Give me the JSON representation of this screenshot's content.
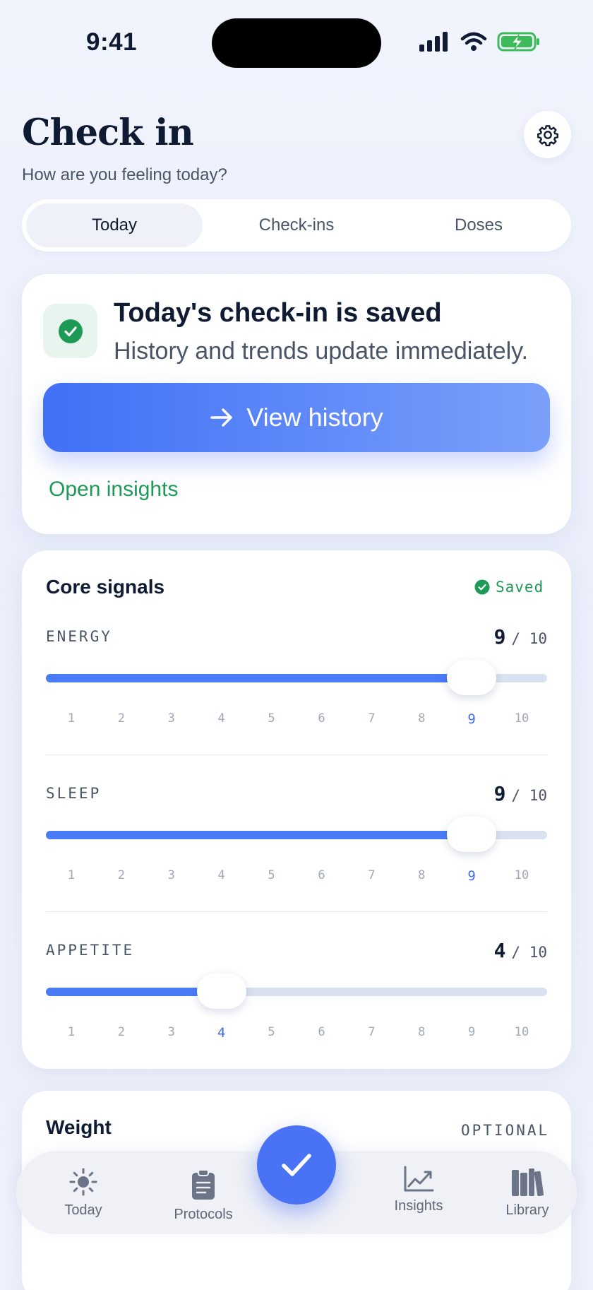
{
  "status_bar": {
    "time": "9:41"
  },
  "header": {
    "title": "Check in",
    "subtitle": "How are you feeling today?"
  },
  "segments": [
    {
      "label": "Today",
      "active": true
    },
    {
      "label": "Check-ins",
      "active": false
    },
    {
      "label": "Doses",
      "active": false
    }
  ],
  "saved_card": {
    "title": "Today's check-in is saved",
    "subtitle": "History and trends update immediately.",
    "button_label": "View history",
    "link_label": "Open insights"
  },
  "signals": {
    "title": "Core signals",
    "saved_label": "Saved",
    "items": [
      {
        "label": "ENERGY",
        "value": 9,
        "max": "/ 10"
      },
      {
        "label": "SLEEP",
        "value": 9,
        "max": "/ 10"
      },
      {
        "label": "APPETITE",
        "value": 4,
        "max": "/ 10"
      }
    ],
    "scale": [
      "1",
      "2",
      "3",
      "4",
      "5",
      "6",
      "7",
      "8",
      "9",
      "10"
    ]
  },
  "weight": {
    "title": "Weight",
    "optional_label": "OPTIONAL"
  },
  "tabbar": {
    "items": [
      {
        "label": "Today",
        "icon": "sun-icon"
      },
      {
        "label": "Protocols",
        "icon": "clipboard-icon"
      },
      {
        "label": "Insights",
        "icon": "chart-icon"
      },
      {
        "label": "Library",
        "icon": "books-icon"
      }
    ],
    "fab_icon": "checkmark-icon"
  },
  "colors": {
    "accent": "#4a7af6",
    "success": "#1e9a57",
    "text": "#0f1a33",
    "muted": "#4a5468"
  }
}
